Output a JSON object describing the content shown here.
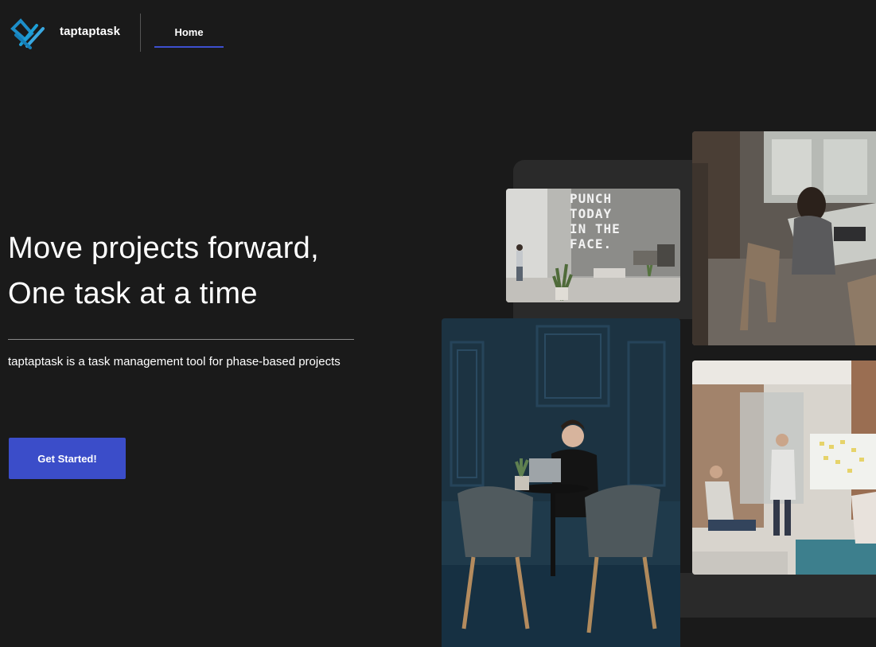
{
  "header": {
    "brand_name": "taptaptask",
    "nav": [
      {
        "label": "Home",
        "active": true
      }
    ]
  },
  "hero": {
    "headline_line1": "Move projects forward,",
    "headline_line2": "One task at a time",
    "tagline": "taptaptask is a task management tool for phase-based projects",
    "cta_label": "Get Started!"
  },
  "gallery": {
    "sign_text": [
      "PUNCH",
      "TODAY",
      "IN THE",
      "FACE."
    ]
  },
  "colors": {
    "background": "#1a1a1a",
    "accent": "#3b4dc9",
    "panel": "#2a2a2a",
    "text": "#ffffff"
  }
}
